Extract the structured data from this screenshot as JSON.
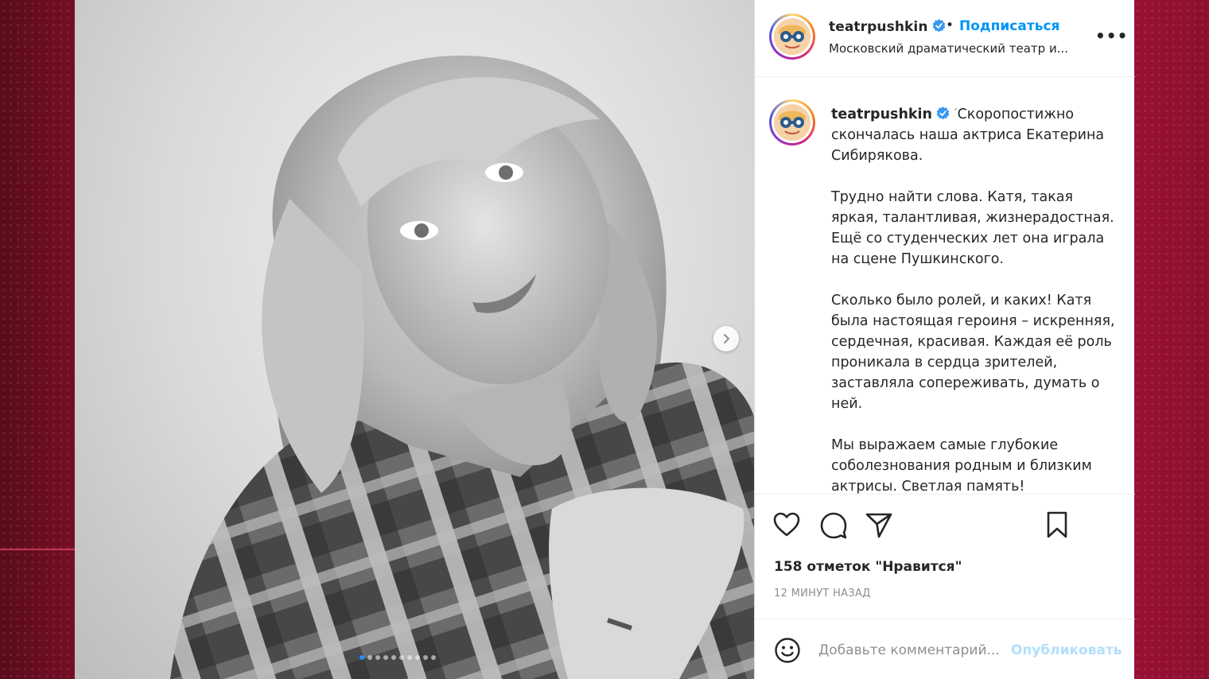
{
  "post": {
    "username": "teatrpushkin",
    "follow_label": "Подписаться",
    "separator": "•",
    "subtitle": "Московский драматический театр и...",
    "more_label": "•••",
    "caption_first": "Скоропостижно скончалась наша актриса Екатерина Сибирякова.",
    "caption_paragraphs": [
      "Трудно найти слова. Катя, такая яркая, талантливая, жизнерадостная. Ещё со студенческих лет она играла на сцене Пушкинского.",
      "Сколько было ролей, и каких! Катя была настоящая героиня – искренняя, сердечная, красивая. Каждая её роль проникала в сердца зрителей, заставляла сопереживать, думать о ней.",
      "Мы выражаем самые глубокие соболезнования родным и близким актрисы. Светлая память!"
    ],
    "likes": "158 отметок \"Нравится\"",
    "time": "12 МИНУТ НАЗАД"
  },
  "comment": {
    "placeholder": "Добавьте комментарий...",
    "publish_label": "Опубликовать"
  },
  "carousel": {
    "slide_count": 10,
    "active_index": 0
  },
  "icons": {
    "like": "heart-icon",
    "comment": "comment-icon",
    "share": "share-icon",
    "save": "bookmark-icon",
    "emoji": "emoji-icon",
    "next": "chevron-right-icon",
    "verified": "verified-badge-icon"
  },
  "colors": {
    "accent": "#0095f6",
    "verified": "#3897f0",
    "publish_disabled": "#b2dffc",
    "background": "#a51337"
  }
}
